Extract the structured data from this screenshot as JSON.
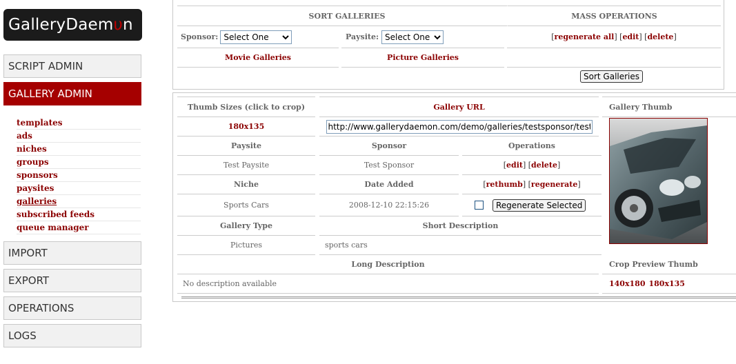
{
  "logo": {
    "text": "GalleryDaem",
    "mark": "υ",
    "tail": "n"
  },
  "sidebar": {
    "script_admin": "SCRIPT ADMIN",
    "gallery_admin": "GALLERY ADMIN",
    "submenu": [
      "templates",
      "ads",
      "niches",
      "groups",
      "sponsors",
      "paysites",
      "galleries",
      "subscribed feeds",
      "queue manager"
    ],
    "import": "IMPORT",
    "export": "EXPORT",
    "operations": "OPERATIONS",
    "logs": "LOGS"
  },
  "sort": {
    "title": "SORT GALLERIES",
    "sponsor_label": "Sponsor:",
    "sponsor_value": "Select One",
    "paysite_label": "Paysite:",
    "paysite_value": "Select One",
    "movie_link": "Movie Galleries",
    "picture_link": "Picture Galleries",
    "sort_button": "Sort Galleries"
  },
  "mass": {
    "title": "MASS OPERATIONS",
    "regen_all": "regenerate all",
    "edit": "edit",
    "delete": "delete"
  },
  "gallery": {
    "thumb_sizes_label": "Thumb Sizes (click to crop)",
    "thumb_size_value": "180x135",
    "url_label": "Gallery URL",
    "url_value": "http://www.gallerydaemon.com/demo/galleries/testsponsor/testpaysite",
    "thumb_label": "Gallery Thumb",
    "paysite_label": "Paysite",
    "paysite_value": "Test Paysite",
    "sponsor_label": "Sponsor",
    "sponsor_value": "Test Sponsor",
    "operations_label": "Operations",
    "op_edit": "edit",
    "op_delete": "delete",
    "niche_label": "Niche",
    "niche_value": "Sports Cars",
    "date_label": "Date Added",
    "date_value": "2008-12-10 22:15:26",
    "op_rethumb": "rethumb",
    "op_regenerate": "regenerate",
    "regen_selected": "Regenerate Selected",
    "type_label": "Gallery Type",
    "type_value": "Pictures",
    "short_desc_label": "Short Description",
    "short_desc_value": "sports cars",
    "long_desc_label": "Long Description",
    "long_desc_value": "No description available",
    "crop_label": "Crop Preview Thumb",
    "crop_140": "140x180",
    "crop_180": "180x135"
  }
}
